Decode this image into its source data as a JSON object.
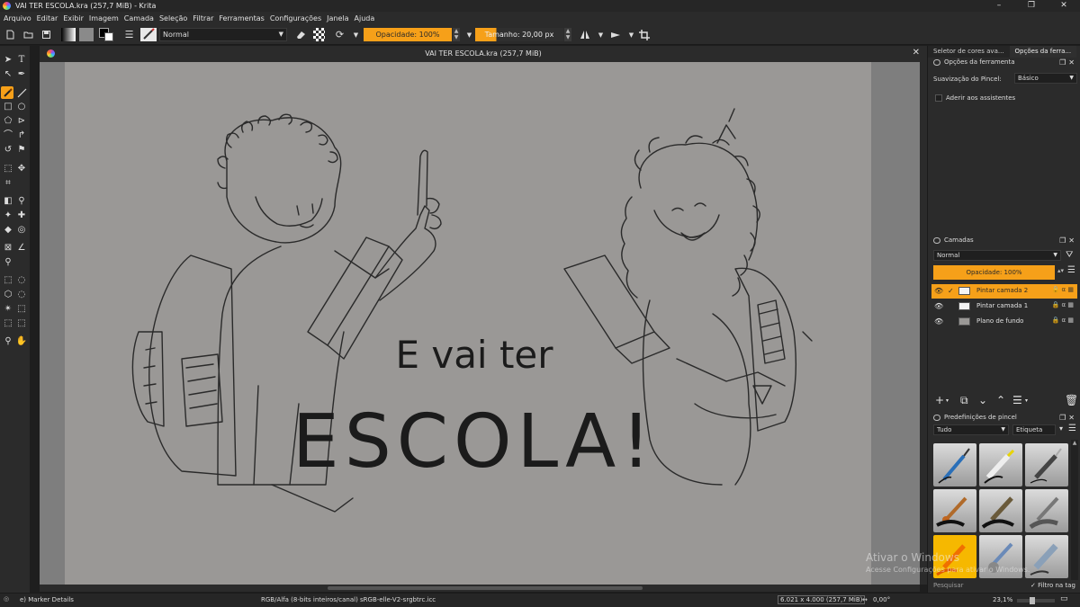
{
  "window": {
    "title": "VAI TER ESCOLA.kra (257,7 MiB)  - Krita",
    "controls": [
      "–",
      "❐",
      "✕"
    ]
  },
  "menubar": [
    "Arquivo",
    "Editar",
    "Exibir",
    "Imagem",
    "Camada",
    "Seleção",
    "Filtrar",
    "Ferramentas",
    "Configurações",
    "Janela",
    "Ajuda"
  ],
  "toolbar": {
    "blend_mode": "Normal",
    "opacity": "Opacidade: 100%",
    "size": "Tamanho: 20,00 px",
    "accent": "#f6a019"
  },
  "document": {
    "tab_title": "VAI TER ESCOLA.kra (257,7 MiB)",
    "close": "✕",
    "lettering_line1": "E vai ter",
    "lettering_line2": "ESCOLA!"
  },
  "tool_options": {
    "tabs": [
      "Seletor de cores ava...",
      "Opções da ferra..."
    ],
    "header": "Opções da ferramenta",
    "smoothing_label": "Suavização do Pincel:",
    "smoothing_value": "Básico",
    "snap_assistants": "Aderir aos assistentes"
  },
  "layers": {
    "header": "Camadas",
    "blend_mode": "Normal",
    "opacity": "Opacidade:  100%",
    "items": [
      {
        "name": "Pintar camada 2",
        "selected": true
      },
      {
        "name": "Pintar camada 1",
        "selected": false
      },
      {
        "name": "Plano de fundo",
        "selected": false
      }
    ]
  },
  "brush_presets": {
    "header": "Predefinições de pincel",
    "filter": "Tudo",
    "tag": "Etiqueta",
    "search_placeholder": "Pesquisar",
    "tag_filter": "Filtro na tag",
    "icons": [
      "fine-liner-brush-icon",
      "marker-brush-icon",
      "ink-pen-brush-icon",
      "round-brush-icon",
      "charcoal-brush-icon",
      "blender-brush-icon",
      "airbrush-brush-icon",
      "smudge-brush-icon",
      "eraser-brush-icon"
    ]
  },
  "statusbar": {
    "tool": "e) Marker Details",
    "color_profile": "RGB/Alfa (8-bits inteiros/canal)  sRGB-elle-V2-srgbtrc.icc",
    "image_size": "6.021 x 4.000 (257,7 MiB)",
    "rotation": "0,00°",
    "zoom": "23,1%"
  },
  "watermark": {
    "line1": "Ativar o Windows",
    "line2": "Acesse Configurações para ativar o Windows."
  }
}
